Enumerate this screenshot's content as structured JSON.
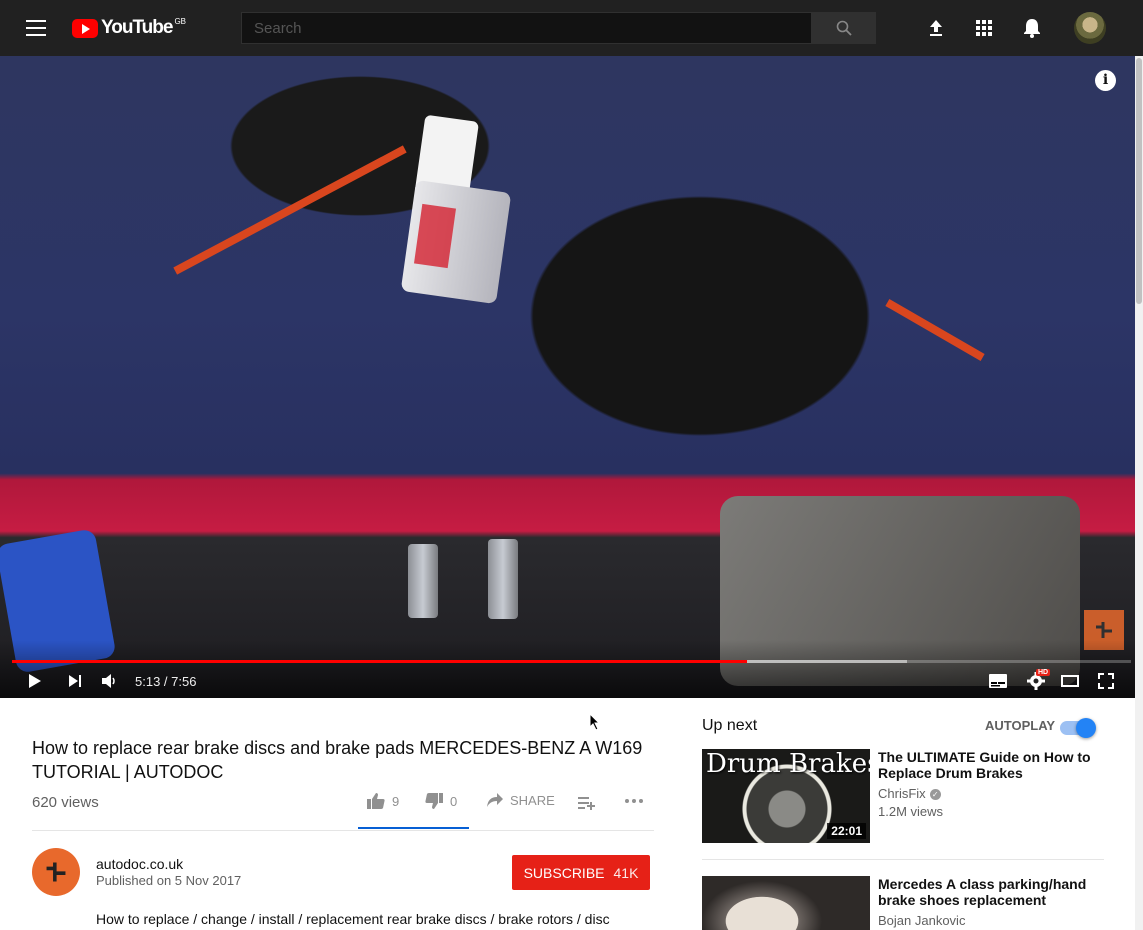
{
  "header": {
    "logo_text": "YouTube",
    "region": "GB",
    "search_placeholder": "Search",
    "icons": [
      "menu-icon",
      "search-icon",
      "upload-icon",
      "apps-icon",
      "notifications-icon",
      "account-avatar"
    ]
  },
  "player": {
    "current_time": "5:13",
    "duration": "7:56",
    "time_display": "5:13 / 7:56",
    "progress_fraction": 0.657,
    "buffered_fraction": 0.8,
    "hd_badge": "HD",
    "info_glyph": "i",
    "colors": {
      "progress": "#ff0000",
      "brand": "#e8692c"
    }
  },
  "video": {
    "title": "How to replace rear brake discs and brake pads MERCEDES-BENZ A W169 TUTORIAL | AUTODOC",
    "views": "620 views",
    "likes": "9",
    "dislikes": "0",
    "share_label": "SHARE"
  },
  "channel": {
    "name": "autodoc.co.uk",
    "published": "Published on 5 Nov 2017",
    "subscribe_label": "SUBSCRIBE",
    "subscriber_count": "41K",
    "description": "How to replace / change / install / replacement rear brake discs / brake rotors / disc"
  },
  "sidebar": {
    "up_next_label": "Up next",
    "autoplay_label": "AUTOPLAY",
    "autoplay_on": true,
    "videos": [
      {
        "thumb_text": "Drum Brakes",
        "duration": "22:01",
        "title": "The ULTIMATE Guide on How to Replace Drum Brakes",
        "channel": "ChrisFix",
        "verified": true,
        "views": "1.2M views"
      },
      {
        "title": "Mercedes A class parking/hand brake shoes replacement",
        "channel": "Bojan Jankovic"
      }
    ]
  }
}
